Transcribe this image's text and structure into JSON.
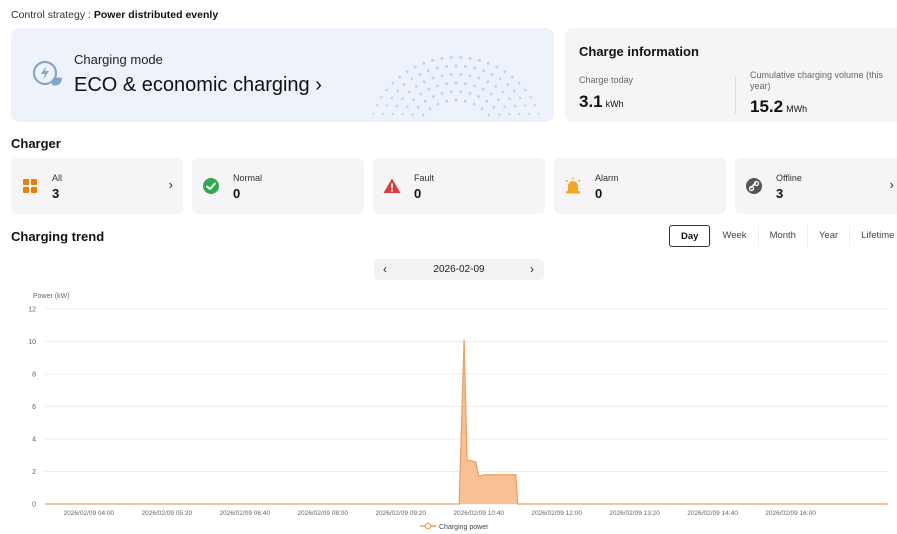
{
  "control_strategy": {
    "label": "Control strategy :",
    "value": "Power distributed evenly"
  },
  "charging_mode": {
    "title": "Charging mode",
    "value": "ECO & economic charging",
    "chevron": "›",
    "icon": "eco-charging-icon"
  },
  "charge_info": {
    "title": "Charge information",
    "today_label": "Charge today",
    "today_value": "3.1",
    "today_unit": "kWh",
    "cumulative_label": "Cumulative charging volume (this year)",
    "cumulative_value": "15.2",
    "cumulative_unit": "MWh"
  },
  "charger": {
    "title": "Charger",
    "stats": [
      {
        "label": "All",
        "value": "3",
        "icon": "grid-icon",
        "color": "#f07d00",
        "chevron": "›"
      },
      {
        "label": "Normal",
        "value": "0",
        "icon": "check-circle-icon",
        "color": "#2fa84f",
        "chevron": ""
      },
      {
        "label": "Fault",
        "value": "0",
        "icon": "warning-triangle-icon",
        "color": "#e0393e",
        "chevron": ""
      },
      {
        "label": "Alarm",
        "value": "0",
        "icon": "alarm-bell-icon",
        "color": "#f5a623",
        "chevron": ""
      },
      {
        "label": "Offline",
        "value": "3",
        "icon": "offline-link-icon",
        "color": "#555555",
        "chevron": "›"
      }
    ]
  },
  "trend": {
    "title": "Charging trend",
    "periods": [
      "Day",
      "Week",
      "Month",
      "Year",
      "Lifetime"
    ],
    "active_period": "Day",
    "date": "2026-02-09",
    "prev": "‹",
    "next": "›"
  },
  "chart_data": {
    "type": "area",
    "ylabel": "Power (kW)",
    "ylim": [
      0,
      12
    ],
    "yticks": [
      0,
      2,
      4,
      6,
      8,
      10,
      12
    ],
    "xlim": [
      "2026/02/09 03:15",
      "2026/02/09 17:40"
    ],
    "xticks": [
      "2026/02/09 04:00",
      "2026/02/09 05:20",
      "2026/02/09 06:40",
      "2026/02/09 08:00",
      "2026/02/09 09:20",
      "2026/02/09 10:40",
      "2026/02/09 12:00",
      "2026/02/09 13:20",
      "2026/02/09 14:40",
      "2026/02/09 16:00"
    ],
    "grid": true,
    "legend": "bottom-center",
    "color": "#f0a060",
    "series": [
      {
        "name": "Charging power",
        "points": [
          [
            "2026/02/09 03:15",
            0
          ],
          [
            "2026/02/09 10:20",
            0
          ],
          [
            "2026/02/09 10:25",
            10.1
          ],
          [
            "2026/02/09 10:28",
            2.7
          ],
          [
            "2026/02/09 10:37",
            2.6
          ],
          [
            "2026/02/09 10:40",
            1.7
          ],
          [
            "2026/02/09 10:46",
            1.8
          ],
          [
            "2026/02/09 11:18",
            1.8
          ],
          [
            "2026/02/09 11:20",
            0
          ],
          [
            "2026/02/09 17:40",
            0
          ]
        ]
      }
    ]
  }
}
